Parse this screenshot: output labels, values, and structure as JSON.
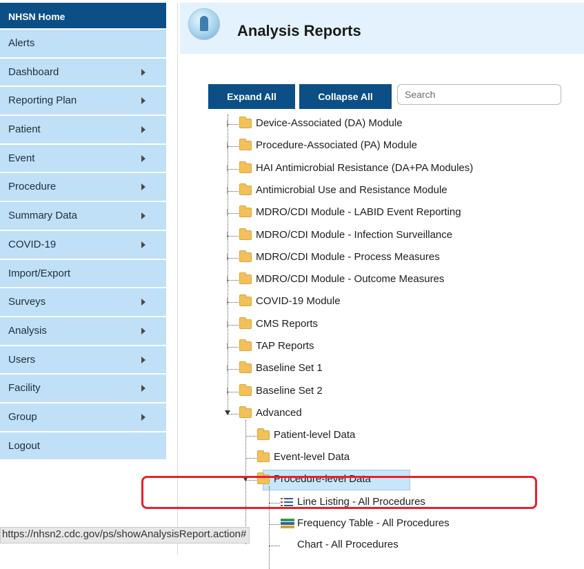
{
  "sidebar": {
    "home": "NHSN Home",
    "items": [
      {
        "label": "Alerts",
        "submenu": false
      },
      {
        "label": "Dashboard",
        "submenu": true
      },
      {
        "label": "Reporting Plan",
        "submenu": true
      },
      {
        "label": "Patient",
        "submenu": true
      },
      {
        "label": "Event",
        "submenu": true
      },
      {
        "label": "Procedure",
        "submenu": true
      },
      {
        "label": "Summary Data",
        "submenu": true
      },
      {
        "label": "COVID-19",
        "submenu": true
      },
      {
        "label": "Import/Export",
        "submenu": false
      },
      {
        "label": "Surveys",
        "submenu": true
      },
      {
        "label": "Analysis",
        "submenu": true
      },
      {
        "label": "Users",
        "submenu": true
      },
      {
        "label": "Facility",
        "submenu": true
      },
      {
        "label": "Group",
        "submenu": true
      },
      {
        "label": "Logout",
        "submenu": false
      }
    ]
  },
  "header": {
    "title": "Analysis Reports"
  },
  "toolbar": {
    "expand_all": "Expand All",
    "collapse_all": "Collapse All",
    "search_placeholder": "Search"
  },
  "tree": {
    "top_nodes": [
      "Device-Associated (DA) Module",
      "Procedure-Associated (PA) Module",
      "HAI Antimicrobial Resistance (DA+PA Modules)",
      "Antimicrobial Use and Resistance Module",
      "MDRO/CDI Module - LABID Event Reporting",
      "MDRO/CDI Module - Infection Surveillance",
      "MDRO/CDI Module - Process Measures",
      "MDRO/CDI Module - Outcome Measures",
      "COVID-19 Module",
      "CMS Reports",
      "TAP Reports",
      "Baseline Set 1",
      "Baseline Set 2",
      "Advanced"
    ],
    "advanced_children": [
      "Patient-level Data",
      "Event-level Data",
      "Procedure-level Data"
    ],
    "procedure_children": [
      "Line Listing - All Procedures",
      "Frequency Table - All Procedures",
      "Chart - All Procedures"
    ]
  },
  "statusbar": {
    "url": "https://nhsn2.cdc.gov/ps/showAnalysisReport.action#"
  }
}
